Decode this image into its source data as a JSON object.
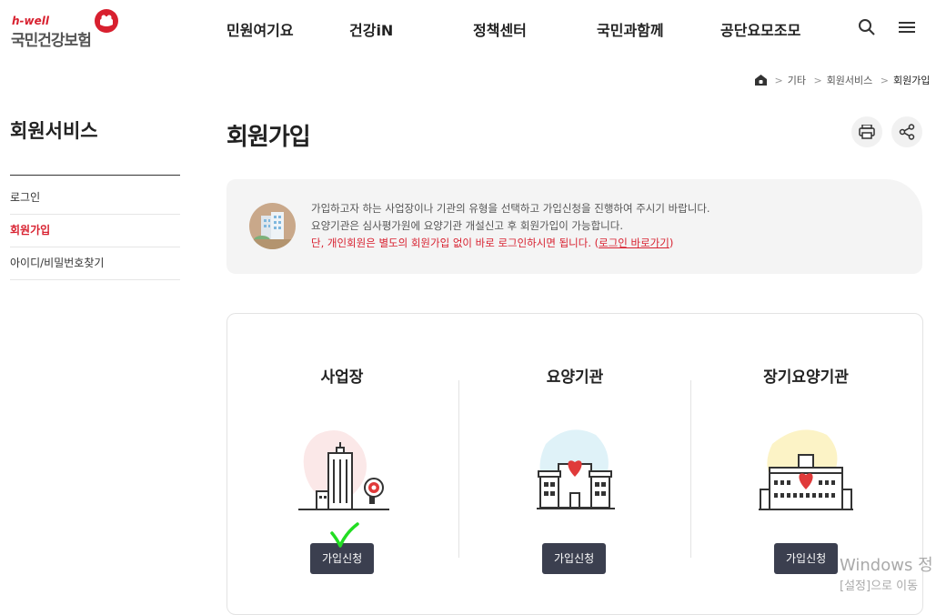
{
  "header": {
    "logo_small": "h-well",
    "logo_main": "국민건강보험",
    "nav": [
      "민원여기요",
      "건강iN",
      "정책센터",
      "국민과함께",
      "공단요모조모"
    ]
  },
  "breadcrumb": [
    "기타",
    "회원서비스",
    "회원가입"
  ],
  "sidebar": {
    "title": "회원서비스",
    "items": [
      {
        "label": "로그인"
      },
      {
        "label": "회원가입"
      },
      {
        "label": "아이디/비밀번호찾기"
      }
    ]
  },
  "page": {
    "title": "회원가입"
  },
  "notice": {
    "line1": "가입하고자 하는 사업장이나 기관의 유형을 선택하고 가입신청을 진행하여 주시기 바랍니다.",
    "line2": "요양기관은 심사평가원에 요양기관 개설신고 후 회원가입이 가능합니다.",
    "line3": "단, 개인회원은 별도의 회원가입 없이 바로 로그인하시면 됩니다. (",
    "line3_link": "로그인 바로가기",
    "line3_end": ")"
  },
  "cards": [
    {
      "title": "사업장",
      "button": "가입신청"
    },
    {
      "title": "요양기관",
      "button": "가입신청"
    },
    {
      "title": "장기요양기관",
      "button": "가입신청"
    }
  ],
  "watermark": {
    "line1": "Windows 정",
    "line2": "[설정]으로 이동"
  },
  "colors": {
    "brand_red": "#d8202f",
    "button_dark": "#3b3f4f",
    "check_green": "#22dd22"
  }
}
